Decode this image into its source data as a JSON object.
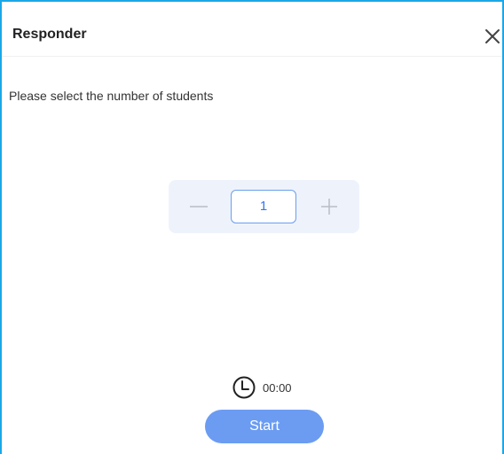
{
  "dialog": {
    "title": "Responder",
    "prompt": "Please select the number of students"
  },
  "stepper": {
    "value": "1",
    "decrement_icon": "minus-icon",
    "increment_icon": "plus-icon"
  },
  "timer": {
    "icon": "clock-icon",
    "value": "00:00"
  },
  "actions": {
    "start_label": "Start",
    "close_icon": "close-icon"
  },
  "colors": {
    "frame": "#1aa7e8",
    "accent": "#6b9cf2",
    "stepper_bg": "#eef3fb",
    "count_text": "#3478f0"
  }
}
